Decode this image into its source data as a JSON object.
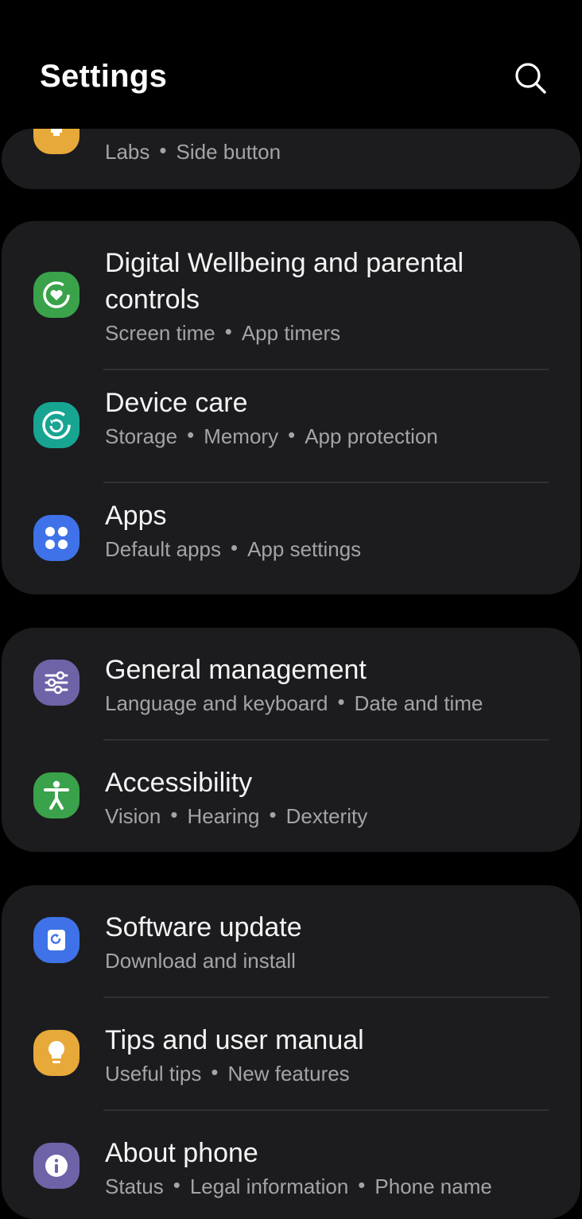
{
  "header": {
    "title": "Settings",
    "search_icon": "search-icon"
  },
  "cards": [
    {
      "rows": [
        {
          "subtitle_parts": [
            "Labs",
            "Side button"
          ],
          "icon": "advanced-features-icon",
          "icon_color": "#e6a93a"
        }
      ]
    },
    {
      "rows": [
        {
          "title": "Digital Wellbeing and parental controls",
          "subtitle_parts": [
            "Screen time",
            "App timers"
          ],
          "icon": "digital-wellbeing-icon",
          "icon_color": "#3aa24a"
        },
        {
          "title": "Device care",
          "subtitle_parts": [
            "Storage",
            "Memory",
            "App protection"
          ],
          "icon": "device-care-icon",
          "icon_color": "#17a592"
        },
        {
          "title": "Apps",
          "subtitle_parts": [
            "Default apps",
            "App settings"
          ],
          "icon": "apps-icon",
          "icon_color": "#3f72e8"
        }
      ]
    },
    {
      "rows": [
        {
          "title": "General management",
          "subtitle_parts": [
            "Language and keyboard",
            "Date and time"
          ],
          "icon": "general-management-icon",
          "icon_color": "#6f63a8"
        },
        {
          "title": "Accessibility",
          "subtitle_parts": [
            "Vision",
            "Hearing",
            "Dexterity"
          ],
          "icon": "accessibility-icon",
          "icon_color": "#3aa24a"
        }
      ]
    },
    {
      "rows": [
        {
          "title": "Software update",
          "subtitle_parts": [
            "Download and install"
          ],
          "icon": "software-update-icon",
          "icon_color": "#3f72e8"
        },
        {
          "title": "Tips and user manual",
          "subtitle_parts": [
            "Useful tips",
            "New features"
          ],
          "icon": "tips-icon",
          "icon_color": "#e6a93a"
        },
        {
          "title": "About phone",
          "subtitle_parts": [
            "Status",
            "Legal information",
            "Phone name"
          ],
          "icon": "about-phone-icon",
          "icon_color": "#6f63a8"
        }
      ]
    }
  ]
}
